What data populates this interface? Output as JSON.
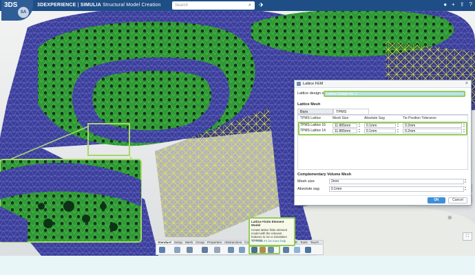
{
  "header": {
    "brand": "3DEXPERIENCE",
    "app": "SIMULIA",
    "title": "Structural Model Creation",
    "search_placeholder": "Search",
    "logo_text": "3DS",
    "badge_text": "SA"
  },
  "dialog": {
    "title": "Lattice FEM",
    "close": "×",
    "design_label": "Lattice design on:",
    "design_value": "Lattice Design No. 1",
    "lattice_mesh_label": "Lattice Mesh",
    "tabs": [
      {
        "label": "Bars"
      },
      {
        "label": "TPMS"
      }
    ],
    "columns": [
      "TPMS Lattice",
      "Mesh Size",
      "Absolute Sag",
      "Tie Position Tolerance"
    ],
    "rows": [
      {
        "name": "TPMS Lattice 16",
        "mesh_size": "11.865mm",
        "sag": "0.1mm",
        "tolerance": "0.2mm"
      },
      {
        "name": "TPMS Lattice 14",
        "mesh_size": "11.865mm",
        "sag": "0.1mm",
        "tolerance": "0.2mm"
      }
    ],
    "complementary_label": "Complementary Volume Mesh",
    "mesh_size_label": "Mesh size",
    "mesh_size_value": "2mm",
    "abs_sag_label": "Absolute sag",
    "abs_sag_value": "0.1mm",
    "ok_label": "OK",
    "cancel_label": "Cancel"
  },
  "tooltip": {
    "title": "Lattice Finite Element Model",
    "desc": "Create lattice finite element model with the relevant features to run a simulation scenario",
    "help": "Press F1 for more help"
  },
  "action_bar": {
    "tabs": [
      "Standard",
      "Setup",
      "Mesh",
      "Group",
      "Properties",
      "Abstractions",
      "Connections",
      "Display",
      "View",
      "AR-VR",
      "Tools",
      "Touch"
    ],
    "active_tab": "Standard"
  },
  "colors": {
    "header_bg": "#1f4e86",
    "mesh_blue": "#3c3f9a",
    "mesh_green": "#2f9a36",
    "lattice_yellow": "#e6e845",
    "highlight_green": "#94cc5a",
    "ok_blue": "#3f8fd8"
  },
  "icons": [
    "search-icon",
    "tag-icon",
    "user-icon",
    "plus-icon",
    "share-icon",
    "help-icon",
    "compass-icon"
  ]
}
